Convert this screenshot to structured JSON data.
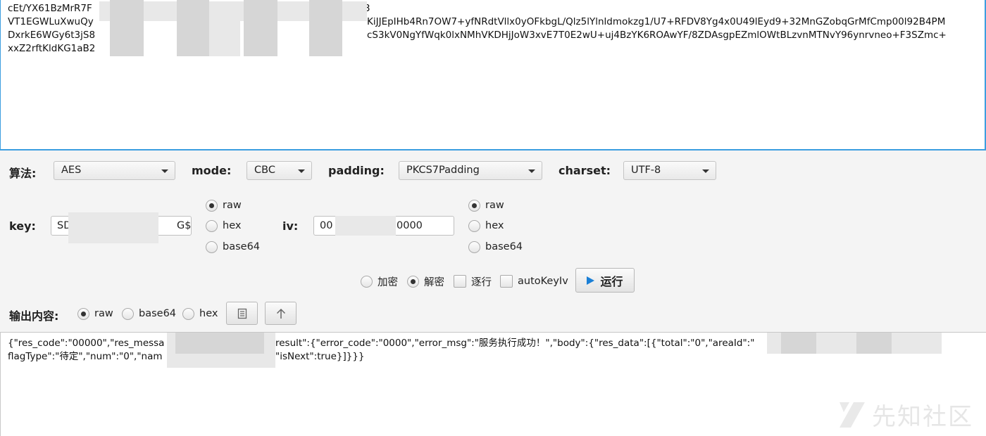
{
  "input": {
    "lines": [
      "cEt/YX61BzMrR7F",
      "VT1EGWLuXwuQy",
      "DxrkE6WGy6t3jS8",
      "xxZ2rftKldKG1aB2"
    ],
    "lines_right": [
      "",
      "KiJJEpIHb4Rn7OW7+yfNRdtVllx0yOFkbgL/Qlz5lYlnldmokzg1/U7+RFDV8Yg4x0U49lEyd9+32MnGZobqGrMfCmp00l92B4PM",
      "cS3kV0NgYfWqk0lxNMhVKDHjJoW3xvE7T0E2wU+uj4BzYK6ROAwYF/8ZDAsgpEZmlOWtBLzvnMTNvY96ynrvneo+F3SZmc+",
      ""
    ],
    "line1_tail": "3"
  },
  "algo": {
    "label": "算法:",
    "value": "AES"
  },
  "mode": {
    "label": "mode:",
    "value": "CBC"
  },
  "padding": {
    "label": "padding:",
    "value": "PKCS7Padding"
  },
  "charset": {
    "label": "charset:",
    "value": "UTF-8"
  },
  "key": {
    "label": "key:",
    "value_start": "SD",
    "value_end": "G$",
    "formats": [
      "raw",
      "hex",
      "base64"
    ],
    "selected": "raw"
  },
  "iv": {
    "label": "iv:",
    "value_start": "00",
    "value_end": "0000",
    "formats": [
      "raw",
      "hex",
      "base64"
    ],
    "selected": "raw"
  },
  "actions": {
    "encrypt_label": "加密",
    "decrypt_label": "解密",
    "selected": "decrypt",
    "line_by_line_label": "逐行",
    "auto_key_iv_label": "autoKeyIv",
    "run_label": "运行"
  },
  "output": {
    "label": "输出内容:",
    "formats": [
      "raw",
      "base64",
      "hex"
    ],
    "selected": "raw",
    "line1_a": "{\"res_code\":\"00000\",\"res_messa",
    "line1_b": "result\":{\"error_code\":\"0000\",\"error_msg\":\"服务执行成功！\",\"body\":{\"res_data\":[{\"total\":\"0\",\"areaId\":\"",
    "line2_a": "flagType\":\"待定\",\"num\":\"0\",\"nam",
    "line2_b": "\"isNext\":true}]}}}"
  },
  "watermark": {
    "text": "先知社区"
  },
  "icons": {
    "copy": "clipboard-icon",
    "up": "arrow-up-icon",
    "run": "play-icon"
  }
}
